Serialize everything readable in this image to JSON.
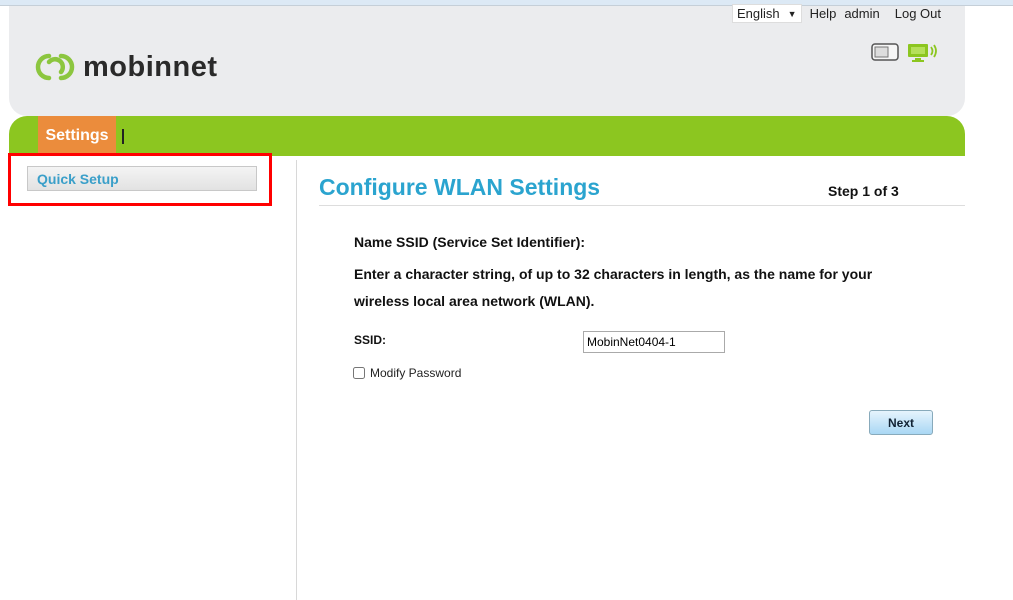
{
  "brand": {
    "name": "mobinnet",
    "accent": "#8cc620",
    "tab_color": "#eb8c3c"
  },
  "toplinks": {
    "language": "English",
    "help": "Help",
    "user": "admin",
    "logout": "Log Out"
  },
  "nav": {
    "tabs": [
      {
        "label": "Settings",
        "active": true
      }
    ]
  },
  "sidebar": {
    "items": [
      {
        "label": "Quick Setup",
        "highlighted": true
      }
    ]
  },
  "main": {
    "title": "Configure WLAN Settings",
    "step": "Step 1 of 3",
    "heading": "Name SSID (Service Set Identifier):",
    "description": "Enter a character string, of up to 32 characters in length, as the name for your wireless local area network (WLAN).",
    "ssid_label": "SSID:",
    "ssid_value": "MobinNet0404-1",
    "modify_password_label": "Modify Password",
    "modify_password_checked": false,
    "next_label": "Next"
  },
  "icons": [
    "device-icon",
    "monitor-wifi-icon"
  ]
}
